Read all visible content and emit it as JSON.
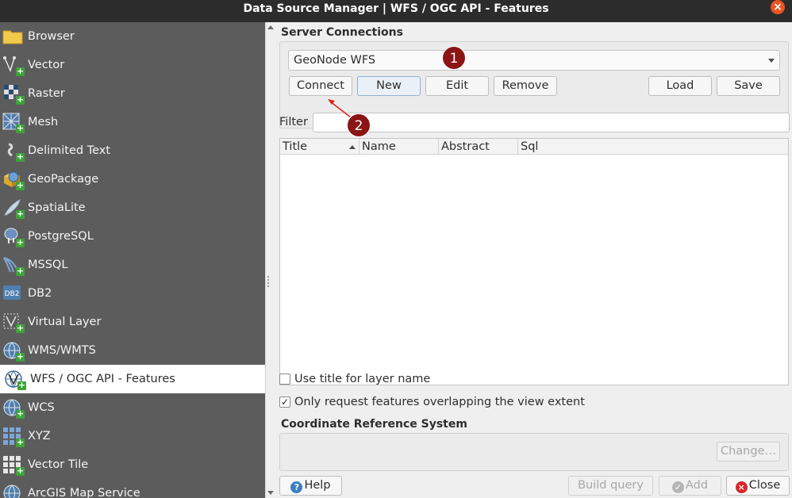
{
  "window": {
    "title": "Data Source Manager | WFS / OGC API - Features"
  },
  "sidebar": {
    "items": [
      {
        "label": "Browser",
        "icon": "folder-icon"
      },
      {
        "label": "Vector",
        "icon": "vector-icon"
      },
      {
        "label": "Raster",
        "icon": "raster-icon"
      },
      {
        "label": "Mesh",
        "icon": "mesh-icon"
      },
      {
        "label": "Delimited Text",
        "icon": "delimited-text-icon"
      },
      {
        "label": "GeoPackage",
        "icon": "geopackage-icon"
      },
      {
        "label": "SpatiaLite",
        "icon": "spatialite-icon"
      },
      {
        "label": "PostgreSQL",
        "icon": "postgresql-icon"
      },
      {
        "label": "MSSQL",
        "icon": "mssql-icon"
      },
      {
        "label": "DB2",
        "icon": "db2-icon"
      },
      {
        "label": "Virtual Layer",
        "icon": "virtual-layer-icon"
      },
      {
        "label": "WMS/WMTS",
        "icon": "wms-icon"
      },
      {
        "label": "WFS / OGC API - Features",
        "icon": "wfs-icon",
        "selected": true
      },
      {
        "label": "WCS",
        "icon": "wcs-icon"
      },
      {
        "label": "XYZ",
        "icon": "xyz-icon"
      },
      {
        "label": "Vector Tile",
        "icon": "vector-tile-icon"
      },
      {
        "label": "ArcGIS Map Service",
        "icon": "arcgis-icon"
      }
    ]
  },
  "server_connections": {
    "title": "Server Connections",
    "selected": "GeoNode WFS",
    "buttons": {
      "connect": "Connect",
      "new": "New",
      "edit": "Edit",
      "remove": "Remove",
      "load": "Load",
      "save": "Save"
    }
  },
  "filter": {
    "label": "Filter",
    "value": ""
  },
  "table": {
    "columns": [
      "Title",
      "Name",
      "Abstract",
      "Sql"
    ]
  },
  "options": {
    "use_title": {
      "label": "Use title for layer name",
      "checked": false
    },
    "only_extent": {
      "label": "Only request features overlapping the view extent",
      "checked": true
    }
  },
  "crs": {
    "title": "Coordinate Reference System",
    "change": "Change…"
  },
  "footer": {
    "help": "Help",
    "build_query": "Build query",
    "add": "Add",
    "close": "Close"
  },
  "annotations": {
    "marker1": "1",
    "marker2": "2"
  },
  "colors": {
    "sidebar_bg": "#5c5c5c",
    "titlebar_bg": "#2c2c2c",
    "marker": "#8b1414",
    "close": "#e95420",
    "arrow": "#e02020"
  }
}
